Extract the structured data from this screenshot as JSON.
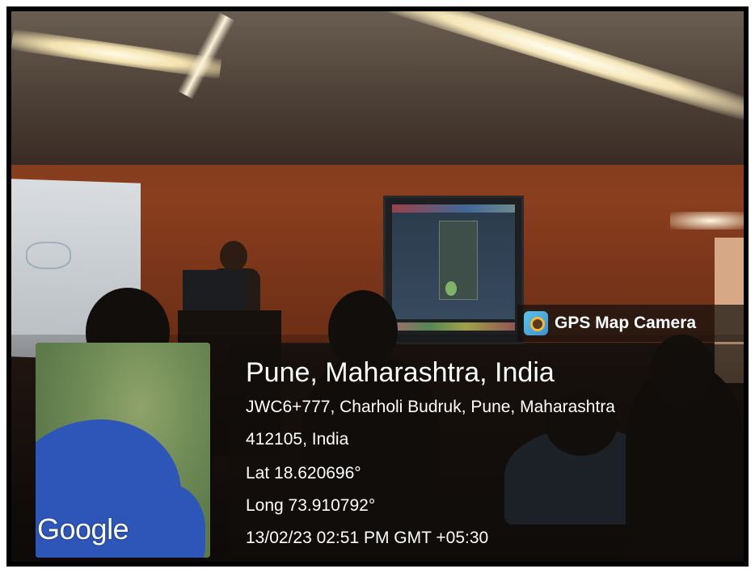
{
  "overlay": {
    "app_name": "GPS Map Camera",
    "app_icon": "camera-lens-icon",
    "map_watermark": "Google",
    "location_title": "Pune, Maharashtra, India",
    "address_line1": "JWC6+777, Charholi Budruk, Pune, Maharashtra",
    "address_line2": "412105, India",
    "latitude": "Lat 18.620696°",
    "longitude": "Long 73.910792°",
    "timestamp": "13/02/23 02:51 PM GMT +05:30"
  },
  "colors": {
    "wall": "#8a3e1e",
    "map_sea": "#2e56b8",
    "overlay_text": "#ffffff"
  }
}
